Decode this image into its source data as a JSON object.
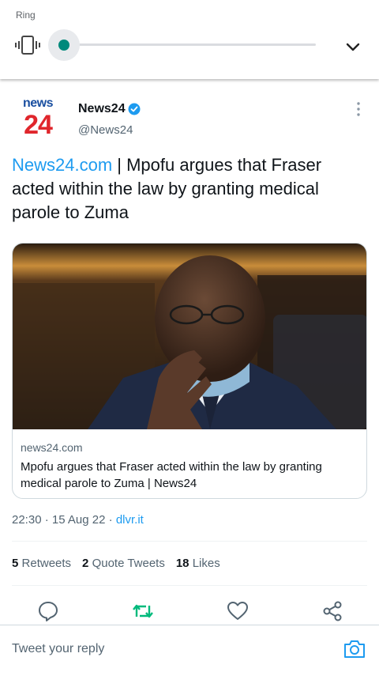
{
  "volume_panel": {
    "label": "Ring",
    "level": 0.0,
    "accent_color": "#00897b",
    "icons": [
      "vibrate-icon",
      "chevron-down-icon"
    ]
  },
  "tweet": {
    "logo": {
      "top": "news",
      "bottom": "24"
    },
    "author_name": "News24",
    "verified": true,
    "handle": "@News24",
    "text_link": "News24.com",
    "text_body": " | Mpofu argues that Fraser acted within the law by granting medical parole to Zuma",
    "card": {
      "domain": "news24.com",
      "title": "Mpofu argues that Fraser acted within the law by granting medical parole to Zuma | News24"
    },
    "time": "22:30",
    "date": "15 Aug 22",
    "source": "dlvr.it",
    "stats": {
      "retweets_count": "5",
      "retweets_label": "Retweets",
      "quotes_count": "2",
      "quotes_label": "Quote Tweets",
      "likes_count": "18",
      "likes_label": "Likes"
    },
    "retweet_color": "#00ba7c"
  },
  "reply": {
    "placeholder": "Tweet your reply"
  }
}
